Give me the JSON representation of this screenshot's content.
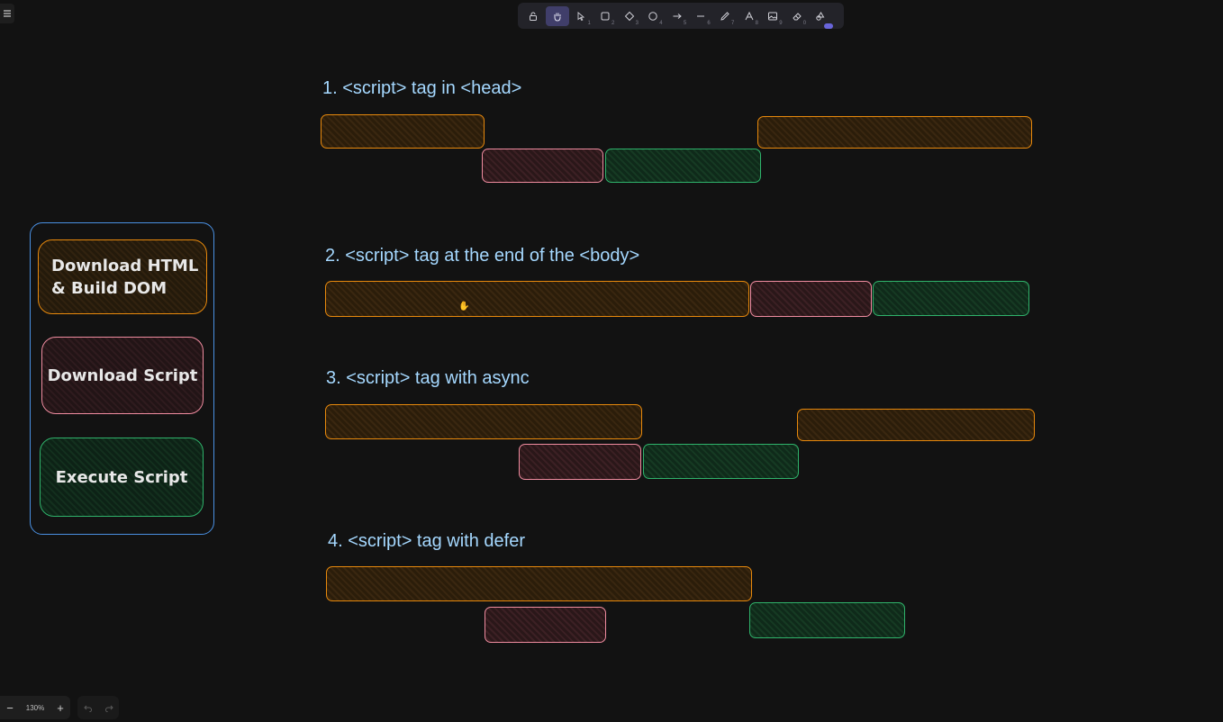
{
  "toolbar": {
    "tools": [
      {
        "name": "lock-tool",
        "icon": "lock-icon",
        "key": ""
      },
      {
        "name": "hand-tool",
        "icon": "hand-icon",
        "key": "",
        "active": true
      },
      {
        "name": "selection-tool",
        "icon": "pointer-icon",
        "key": "1"
      },
      {
        "name": "rectangle-tool",
        "icon": "square-icon",
        "key": "2"
      },
      {
        "name": "diamond-tool",
        "icon": "diamond-icon",
        "key": "3"
      },
      {
        "name": "ellipse-tool",
        "icon": "circle-icon",
        "key": "4"
      },
      {
        "name": "arrow-tool",
        "icon": "arrow-icon",
        "key": "5"
      },
      {
        "name": "line-tool",
        "icon": "line-icon",
        "key": "6"
      },
      {
        "name": "draw-tool",
        "icon": "pencil-icon",
        "key": "7"
      },
      {
        "name": "text-tool",
        "icon": "text-icon",
        "key": "8"
      },
      {
        "name": "image-tool",
        "icon": "image-icon",
        "key": "9"
      },
      {
        "name": "eraser-tool",
        "icon": "eraser-icon",
        "key": "0"
      },
      {
        "name": "more-tools",
        "icon": "shapes-icon",
        "key": ""
      }
    ]
  },
  "sections": [
    {
      "title": "1. <script> tag in <head>"
    },
    {
      "title": "2. <script> tag at the end of the <body>"
    },
    {
      "title": "3. <script> tag with async"
    },
    {
      "title": "4. <script> tag with defer"
    }
  ],
  "legend": {
    "html": "Download HTML\n& Build DOM",
    "download": "Download Script",
    "execute": "Execute Script"
  },
  "zoom": {
    "minus": "−",
    "value": "130%",
    "plus": "+"
  },
  "colors": {
    "html": "#e8890c",
    "download": "#f08ca0",
    "execute": "#2fb36b",
    "title": "#a5d8ff",
    "legend_border": "#4a90e2",
    "accent": "#6965db"
  }
}
